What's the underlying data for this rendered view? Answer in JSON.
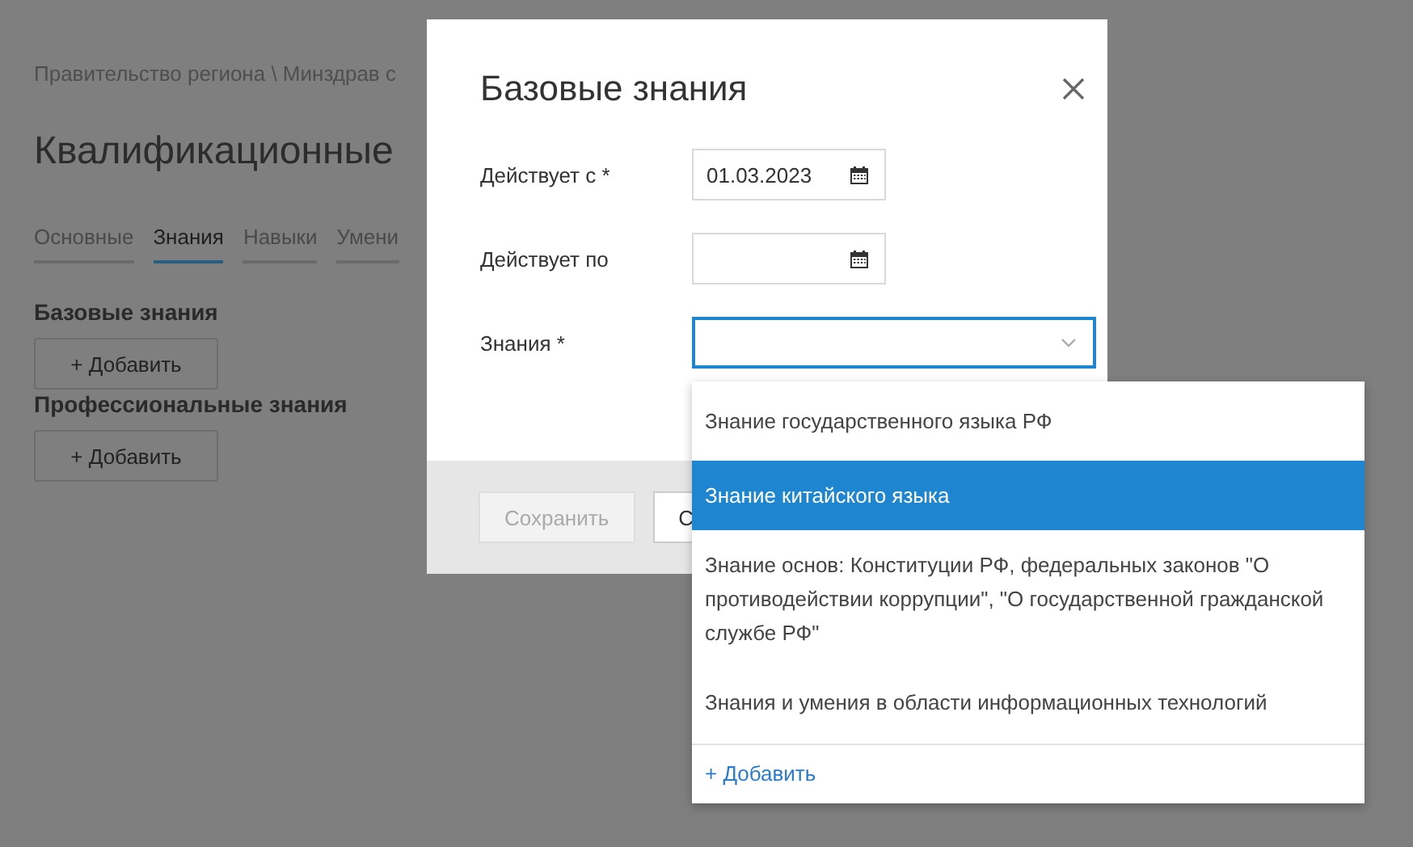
{
  "breadcrumb": "Правительство региона \\ Минздрав с",
  "page_title": "Квалификационные",
  "tabs": [
    {
      "label": "Основные",
      "selected": false
    },
    {
      "label": "Знания",
      "selected": true
    },
    {
      "label": "Навыки",
      "selected": false
    },
    {
      "label": "Умени",
      "selected": false
    }
  ],
  "sections": [
    {
      "title": "Базовые знания",
      "add_button": "+ Добавить"
    },
    {
      "title": "Профессиональные знания",
      "add_button": "+ Добавить"
    }
  ],
  "dialog": {
    "title": "Базовые знания",
    "fields": [
      {
        "kind": "date",
        "label": "Действует с *",
        "value": "01.03.2023"
      },
      {
        "kind": "date",
        "label": "Действует по"
      },
      {
        "kind": "select",
        "label": "Знания *"
      }
    ],
    "buttons": [
      {
        "label": "Сохранить",
        "disabled": true
      },
      {
        "label": "С",
        "disabled": false
      }
    ]
  },
  "dropdown": {
    "options": [
      {
        "label": "Знание государственного языка РФ",
        "selected": false
      },
      {
        "label": "Знание китайского языка",
        "selected": true
      },
      {
        "label": "Знание основ: Конституции РФ, федеральных законов \"О противодействии коррупции\", \"О государственной гражданской службе РФ\"",
        "selected": false
      },
      {
        "label": "Знания и умения в области информационных технологий",
        "selected": false
      }
    ],
    "add_link": "+ Добавить"
  }
}
